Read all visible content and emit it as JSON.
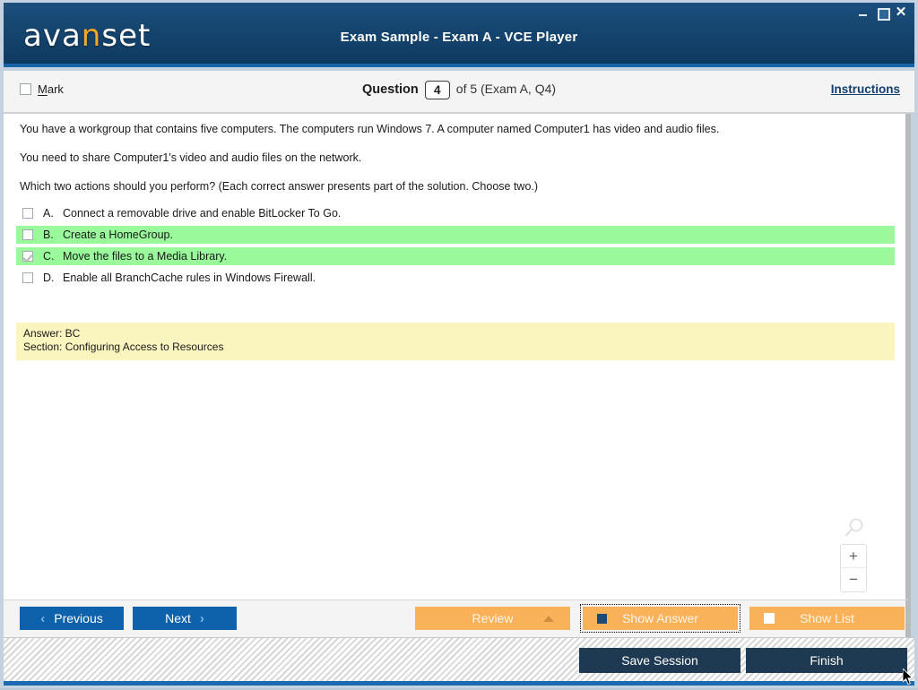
{
  "window": {
    "logo_pre": "ava",
    "logo_accent": "n",
    "logo_post": "set",
    "title": "Exam Sample - Exam A - VCE Player",
    "minimize_label": "",
    "maximize_label": "",
    "close_label": "✕",
    "titlebar_color": "#15456f",
    "accent_color": "#1565a8"
  },
  "question_header": {
    "mark_label": "Mark",
    "mark_checked": false,
    "question_label": "Question",
    "question_number": "4",
    "question_of": "of 5 (Exam A, Q4)",
    "instructions_label": "Instructions"
  },
  "question": {
    "paragraphs": [
      "You have a workgroup that contains five computers. The computers run Windows 7. A computer named Computer1 has video and audio files.",
      "You need to share Computer1's video and audio files on the network.",
      "Which two actions should you perform? (Each correct answer presents part of the solution. Choose two.)"
    ],
    "options": [
      {
        "letter": "A.",
        "text": "Connect a removable drive and enable BitLocker To Go.",
        "checked": false,
        "highlighted": false
      },
      {
        "letter": "B.",
        "text": "Create a HomeGroup.",
        "checked": false,
        "highlighted": true
      },
      {
        "letter": "C.",
        "text": "Move the files to a Media Library.",
        "checked": true,
        "highlighted": true
      },
      {
        "letter": "D.",
        "text": "Enable all BranchCache rules in Windows Firewall.",
        "checked": false,
        "highlighted": false
      }
    ],
    "highlight_color": "#99f99b"
  },
  "answer_box": {
    "answer_line": "Answer: BC",
    "section_line": "Section: Configuring Access to Resources",
    "background_color": "#faf4bf"
  },
  "zoom_widget": {
    "magnifier_icon": "magnifier-icon",
    "zoom_in_label": "+",
    "zoom_out_label": "−"
  },
  "action_bar": {
    "previous_label": "Previous",
    "previous_chevron": "‹",
    "next_label": "Next",
    "next_chevron": "›",
    "review_label": "Review",
    "show_answer_label": "Show Answer",
    "show_list_label": "Show List",
    "nav_button_color": "#0d62ab",
    "orange_button_color": "#f9b259"
  },
  "footer": {
    "save_session_label": "Save Session",
    "finish_label": "Finish",
    "dark_button_color": "#1e3a52",
    "rail_color": "#1a6bb0"
  }
}
